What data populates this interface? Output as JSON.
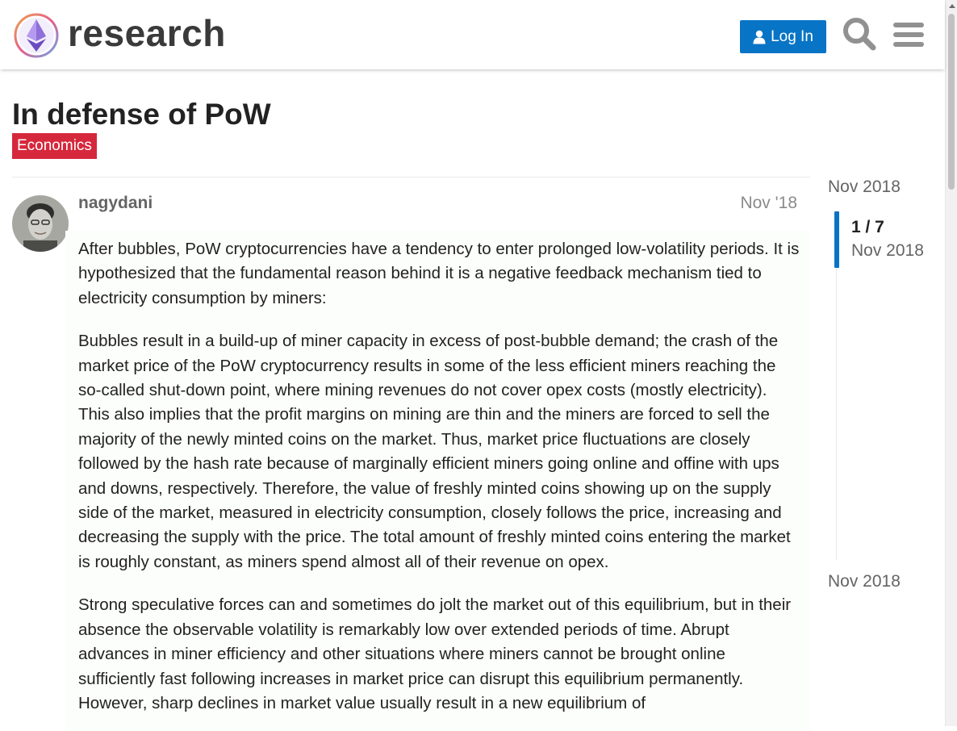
{
  "header": {
    "site_name": "research",
    "login_label": "Log In",
    "icons": [
      "ethereum-logo-icon",
      "user-icon",
      "search-icon",
      "hamburger-menu-icon"
    ],
    "colors": {
      "primary": "#0874c6",
      "logo_text": "#3a3a3a"
    }
  },
  "topic": {
    "title": "In defense of PoW",
    "category": "Economics",
    "category_color": "#d6283c"
  },
  "post": {
    "username": "nagydani",
    "date": "Nov '18",
    "paragraphs": [
      "After bubbles, PoW cryptocurrencies have a tendency to enter prolonged low-volatility periods. It is hypothesized that the fundamental reason behind it is a negative feedback mechanism tied to electricity consumption by miners:",
      "Bubbles result in a build-up of miner capacity in excess of post-bubble demand; the crash of the market price of the PoW cryptocurrency results in some of the less efficient miners reaching the so-called shut-down point, where mining revenues do not cover opex costs (mostly electricity). This also implies that the profit margins on mining are thin and the miners are forced to sell the majority of the newly minted coins on the market. Thus, market price fluctuations are closely followed by the hash rate because of marginally efficient miners going online and offine with ups and downs, respectively. Therefore, the value of freshly minted coins showing up on the supply side of the market, measured in electricity consumption, closely follows the price, increasing and decreasing the supply with the price. The total amount of freshly minted coins entering the market is roughly constant, as miners spend almost all of their revenue on opex.",
      "Strong speculative forces can and sometimes do jolt the market out of this equilibrium, but in their absence the observable volatility is remarkably low over extended periods of time. Abrupt advances in miner efficiency and other situations where miners cannot be brought online sufficiently fast following increases in market price can disrupt this equilibrium permanently. However, sharp declines in market value usually result in a new equilibrium of"
    ]
  },
  "timeline": {
    "start_date": "Nov 2018",
    "counter": "1 / 7",
    "handle_date": "Nov 2018",
    "end_date": "Nov 2018",
    "progress_fraction": 0.14
  }
}
